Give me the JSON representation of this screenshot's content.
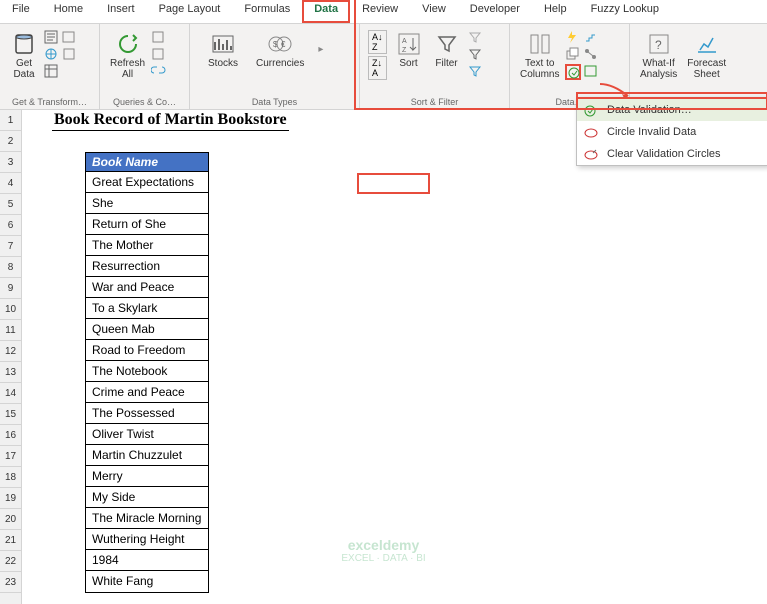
{
  "tabs": {
    "file": "File",
    "home": "Home",
    "insert": "Insert",
    "pageLayout": "Page Layout",
    "formulas": "Formulas",
    "data": "Data",
    "review": "Review",
    "view": "View",
    "developer": "Developer",
    "help": "Help",
    "fuzzy": "Fuzzy Lookup"
  },
  "ribbon": {
    "getData": "Get\nData",
    "refreshAll": "Refresh\nAll",
    "stocks": "Stocks",
    "currencies": "Currencies",
    "sort": "Sort",
    "filter": "Filter",
    "textToColumns": "Text to\nColumns",
    "whatIf": "What-If\nAnalysis",
    "forecast": "Forecast\nSheet",
    "groups": {
      "getTransform": "Get & Transform…",
      "queries": "Queries & Co…",
      "dataTypes": "Data Types",
      "sortFilter": "Sort & Filter",
      "dataTools": "Data…"
    }
  },
  "dropdown": {
    "dataValidation": "Data Validation…",
    "circleInvalid": "Circle Invalid Data",
    "clearCircles": "Clear Validation Circles"
  },
  "sheet": {
    "title": "Book Record of Martin Bookstore",
    "header": "Book Name",
    "books": [
      "Great Expectations",
      "She",
      "Return of She",
      "The Mother",
      "Resurrection",
      "War and Peace",
      "To a Skylark",
      "Queen Mab",
      "Road to Freedom",
      "The Notebook",
      "Crime and Peace",
      "The Possessed",
      "Oliver Twist",
      "Martin Chuzzulet",
      "Merry",
      "My Side",
      "The Miracle Morning",
      "Wuthering Height",
      "1984",
      "White Fang"
    ],
    "rowNums": [
      "1",
      "2",
      "3",
      "4",
      "5",
      "6",
      "7",
      "8",
      "9",
      "10",
      "11",
      "12",
      "13",
      "14",
      "15",
      "16",
      "17",
      "18",
      "19",
      "20",
      "21",
      "22",
      "23"
    ]
  },
  "watermark": {
    "brand": "exceldemy",
    "tag": "EXCEL · DATA · BI"
  }
}
